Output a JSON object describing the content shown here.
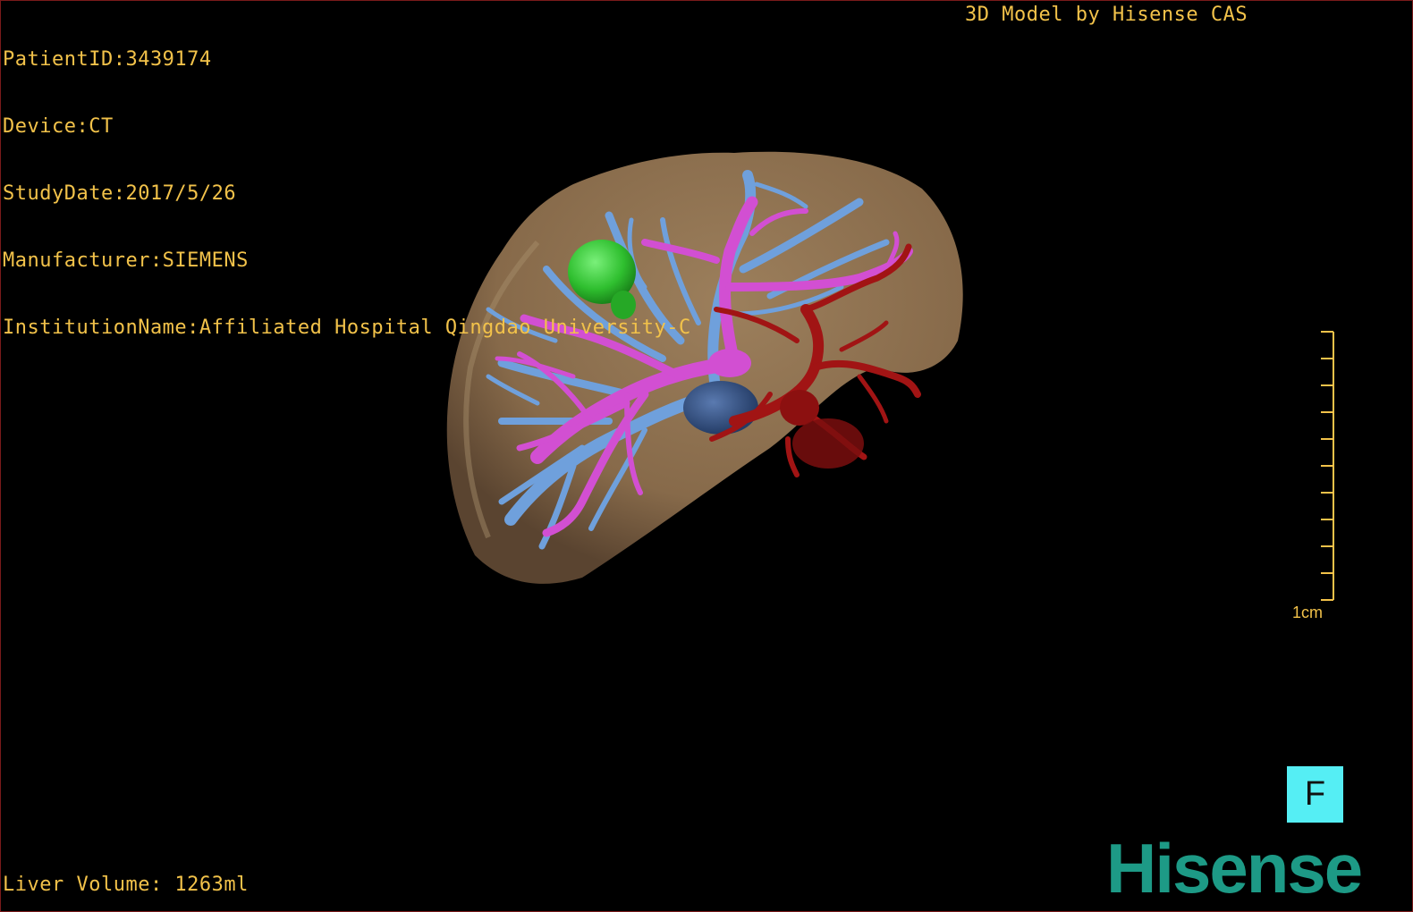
{
  "info": {
    "patient_id": "PatientID:3439174",
    "device": "Device:CT",
    "study_date": "StudyDate:2017/5/26",
    "manufacturer": "Manufacturer:SIEMENS",
    "institution": "InstitutionName:Affiliated Hospital Qingdao University-C"
  },
  "credit": "3D Model by Hisense CAS",
  "volume": "Liver Volume: 1263ml",
  "scale": {
    "label": "1cm"
  },
  "orientation": {
    "label": "F"
  },
  "logo": {
    "text": "Hisense"
  },
  "colors": {
    "text": "#f2c24a",
    "liver": "#8c6e4e",
    "portal_vein": "#6fa0dc",
    "hepatic_vein": "#d24fd2",
    "artery": "#a11414",
    "gallbladder": "#2fbf2f",
    "ivc": "#3a5a8c",
    "orientation_box": "#55eef4",
    "logo": "#1d9a86"
  }
}
